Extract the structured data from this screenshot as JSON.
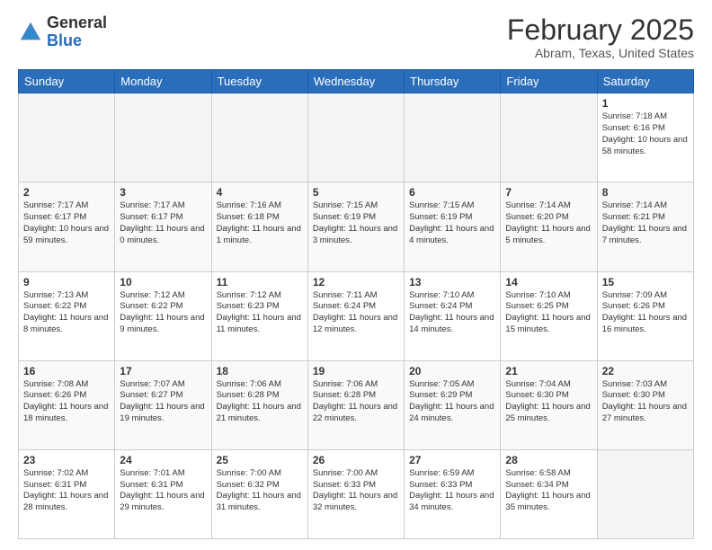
{
  "header": {
    "logo": {
      "general": "General",
      "blue": "Blue"
    },
    "title": "February 2025",
    "location": "Abram, Texas, United States"
  },
  "weekdays": [
    "Sunday",
    "Monday",
    "Tuesday",
    "Wednesday",
    "Thursday",
    "Friday",
    "Saturday"
  ],
  "weeks": [
    [
      {
        "day": "",
        "empty": true
      },
      {
        "day": "",
        "empty": true
      },
      {
        "day": "",
        "empty": true
      },
      {
        "day": "",
        "empty": true
      },
      {
        "day": "",
        "empty": true
      },
      {
        "day": "",
        "empty": true
      },
      {
        "day": "1",
        "sunrise": "7:18 AM",
        "sunset": "6:16 PM",
        "daylight": "10 hours and 58 minutes."
      }
    ],
    [
      {
        "day": "2",
        "sunrise": "7:17 AM",
        "sunset": "6:17 PM",
        "daylight": "10 hours and 59 minutes."
      },
      {
        "day": "3",
        "sunrise": "7:17 AM",
        "sunset": "6:17 PM",
        "daylight": "11 hours and 0 minutes."
      },
      {
        "day": "4",
        "sunrise": "7:16 AM",
        "sunset": "6:18 PM",
        "daylight": "11 hours and 1 minute."
      },
      {
        "day": "5",
        "sunrise": "7:15 AM",
        "sunset": "6:19 PM",
        "daylight": "11 hours and 3 minutes."
      },
      {
        "day": "6",
        "sunrise": "7:15 AM",
        "sunset": "6:19 PM",
        "daylight": "11 hours and 4 minutes."
      },
      {
        "day": "7",
        "sunrise": "7:14 AM",
        "sunset": "6:20 PM",
        "daylight": "11 hours and 5 minutes."
      },
      {
        "day": "8",
        "sunrise": "7:14 AM",
        "sunset": "6:21 PM",
        "daylight": "11 hours and 7 minutes."
      }
    ],
    [
      {
        "day": "9",
        "sunrise": "7:13 AM",
        "sunset": "6:22 PM",
        "daylight": "11 hours and 8 minutes."
      },
      {
        "day": "10",
        "sunrise": "7:12 AM",
        "sunset": "6:22 PM",
        "daylight": "11 hours and 9 minutes."
      },
      {
        "day": "11",
        "sunrise": "7:12 AM",
        "sunset": "6:23 PM",
        "daylight": "11 hours and 11 minutes."
      },
      {
        "day": "12",
        "sunrise": "7:11 AM",
        "sunset": "6:24 PM",
        "daylight": "11 hours and 12 minutes."
      },
      {
        "day": "13",
        "sunrise": "7:10 AM",
        "sunset": "6:24 PM",
        "daylight": "11 hours and 14 minutes."
      },
      {
        "day": "14",
        "sunrise": "7:10 AM",
        "sunset": "6:25 PM",
        "daylight": "11 hours and 15 minutes."
      },
      {
        "day": "15",
        "sunrise": "7:09 AM",
        "sunset": "6:26 PM",
        "daylight": "11 hours and 16 minutes."
      }
    ],
    [
      {
        "day": "16",
        "sunrise": "7:08 AM",
        "sunset": "6:26 PM",
        "daylight": "11 hours and 18 minutes."
      },
      {
        "day": "17",
        "sunrise": "7:07 AM",
        "sunset": "6:27 PM",
        "daylight": "11 hours and 19 minutes."
      },
      {
        "day": "18",
        "sunrise": "7:06 AM",
        "sunset": "6:28 PM",
        "daylight": "11 hours and 21 minutes."
      },
      {
        "day": "19",
        "sunrise": "7:06 AM",
        "sunset": "6:28 PM",
        "daylight": "11 hours and 22 minutes."
      },
      {
        "day": "20",
        "sunrise": "7:05 AM",
        "sunset": "6:29 PM",
        "daylight": "11 hours and 24 minutes."
      },
      {
        "day": "21",
        "sunrise": "7:04 AM",
        "sunset": "6:30 PM",
        "daylight": "11 hours and 25 minutes."
      },
      {
        "day": "22",
        "sunrise": "7:03 AM",
        "sunset": "6:30 PM",
        "daylight": "11 hours and 27 minutes."
      }
    ],
    [
      {
        "day": "23",
        "sunrise": "7:02 AM",
        "sunset": "6:31 PM",
        "daylight": "11 hours and 28 minutes."
      },
      {
        "day": "24",
        "sunrise": "7:01 AM",
        "sunset": "6:31 PM",
        "daylight": "11 hours and 29 minutes."
      },
      {
        "day": "25",
        "sunrise": "7:00 AM",
        "sunset": "6:32 PM",
        "daylight": "11 hours and 31 minutes."
      },
      {
        "day": "26",
        "sunrise": "7:00 AM",
        "sunset": "6:33 PM",
        "daylight": "11 hours and 32 minutes."
      },
      {
        "day": "27",
        "sunrise": "6:59 AM",
        "sunset": "6:33 PM",
        "daylight": "11 hours and 34 minutes."
      },
      {
        "day": "28",
        "sunrise": "6:58 AM",
        "sunset": "6:34 PM",
        "daylight": "11 hours and 35 minutes."
      },
      {
        "day": "",
        "empty": true
      }
    ]
  ]
}
